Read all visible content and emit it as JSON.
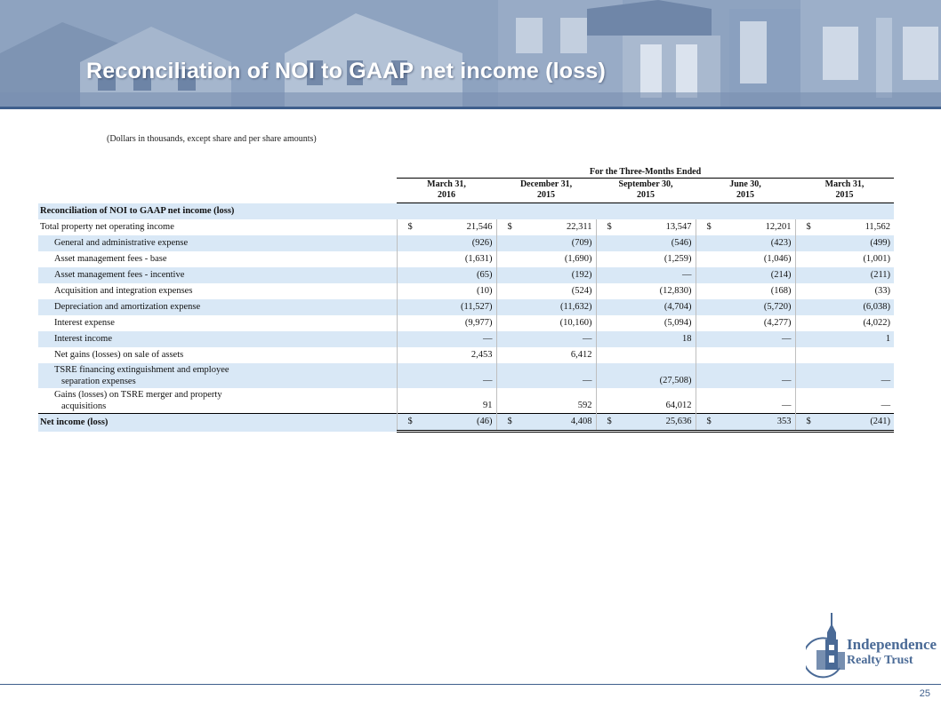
{
  "header": {
    "title": "Reconciliation of NOI to GAAP net income (loss)"
  },
  "subtitle": "(Dollars in thousands, except share and per share amounts)",
  "table": {
    "period_title": "For the Three-Months Ended",
    "columns": [
      {
        "line1": "March 31,",
        "line2": "2016"
      },
      {
        "line1": "December 31,",
        "line2": "2015"
      },
      {
        "line1": "September 30,",
        "line2": "2015"
      },
      {
        "line1": "June 30,",
        "line2": "2015"
      },
      {
        "line1": "March 31,",
        "line2": "2015"
      }
    ],
    "section_label": "Reconciliation of NOI to GAAP net income (loss)",
    "currency_symbol": "$",
    "rows": [
      {
        "label": "Total property net operating income",
        "values": [
          "21,546",
          "22,311",
          "13,547",
          "12,201",
          "11,562"
        ]
      },
      {
        "label": "General and administrative expense",
        "values": [
          "(926)",
          "(709)",
          "(546)",
          "(423)",
          "(499)"
        ]
      },
      {
        "label": "Asset management fees - base",
        "values": [
          "(1,631)",
          "(1,690)",
          "(1,259)",
          "(1,046)",
          "(1,001)"
        ]
      },
      {
        "label": "Asset management fees - incentive",
        "values": [
          "(65)",
          "(192)",
          "—",
          "(214)",
          "(211)"
        ]
      },
      {
        "label": "Acquisition and integration expenses",
        "values": [
          "(10)",
          "(524)",
          "(12,830)",
          "(168)",
          "(33)"
        ]
      },
      {
        "label": "Depreciation and amortization expense",
        "values": [
          "(11,527)",
          "(11,632)",
          "(4,704)",
          "(5,720)",
          "(6,038)"
        ]
      },
      {
        "label": "Interest expense",
        "values": [
          "(9,977)",
          "(10,160)",
          "(5,094)",
          "(4,277)",
          "(4,022)"
        ]
      },
      {
        "label": "Interest income",
        "values": [
          "—",
          "—",
          "18",
          "—",
          "1"
        ]
      },
      {
        "label": "Net gains (losses) on sale of assets",
        "values": [
          "2,453",
          "6,412",
          "",
          "",
          ""
        ]
      },
      {
        "label_line1": "TSRE financing extinguishment and employee",
        "label_line2": "separation expenses",
        "values": [
          "—",
          "—",
          "(27,508)",
          "—",
          "—"
        ]
      },
      {
        "label_line1": "Gains (losses) on TSRE merger and property",
        "label_line2": "acquisitions",
        "values": [
          "91",
          "592",
          "64,012",
          "—",
          "—"
        ]
      }
    ],
    "total": {
      "label": "Net income (loss)",
      "values": [
        "(46)",
        "4,408",
        "25,636",
        "353",
        "(241)"
      ]
    }
  },
  "logo": {
    "line1": "Independence",
    "line2": "Realty Trust"
  },
  "page_number": "25",
  "colors": {
    "brand_blue": "#3f5f8c",
    "row_shade": "#d9e8f6",
    "logo_blue": "#4a6a96"
  }
}
